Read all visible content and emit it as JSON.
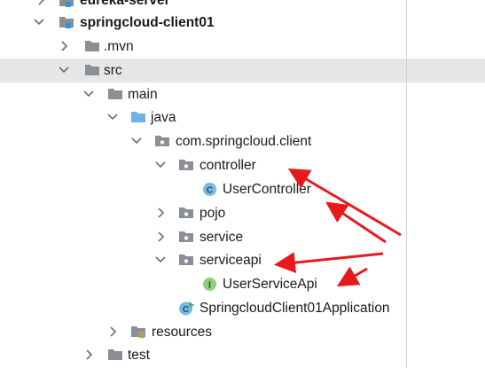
{
  "tree": {
    "items": [
      {
        "label": "eureka-server"
      },
      {
        "label": "springcloud-client01"
      },
      {
        "label": ".mvn"
      },
      {
        "label": "src"
      },
      {
        "label": "main"
      },
      {
        "label": "java"
      },
      {
        "label": "com.springcloud.client"
      },
      {
        "label": "controller"
      },
      {
        "label": "UserController"
      },
      {
        "label": "pojo"
      },
      {
        "label": "service"
      },
      {
        "label": "serviceapi"
      },
      {
        "label": "UserServiceApi"
      },
      {
        "label": "SpringcloudClient01Application"
      },
      {
        "label": "resources"
      },
      {
        "label": "test"
      }
    ],
    "badges": {
      "class": "C",
      "interface": "I"
    }
  },
  "colors": {
    "arrow": "#e8191c",
    "selection": "#e6e6e6",
    "folder": "#8a8f96",
    "module_folder": "#8a8f96",
    "module_marker": "#3c8fd9",
    "java_folder": "#6fb3e6",
    "class_badge": "#78bbe0",
    "interface_badge": "#8fcf7a"
  }
}
